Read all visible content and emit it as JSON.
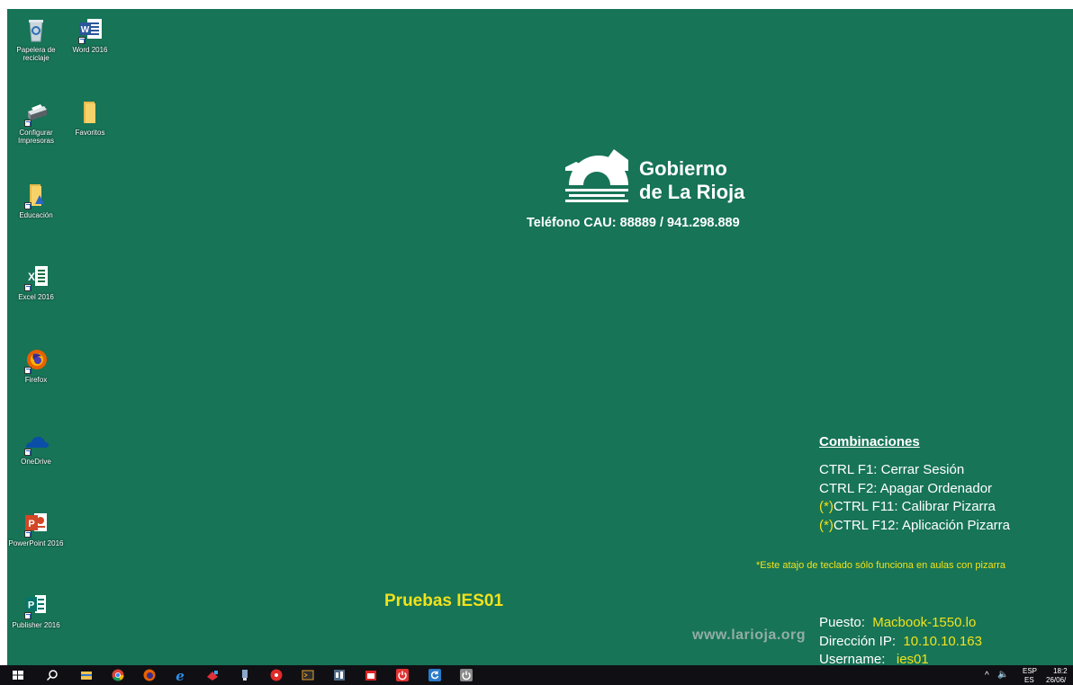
{
  "desktop": {
    "icons": [
      {
        "label": "Papelera de reciclaje",
        "icon": "recycle-bin-icon"
      },
      {
        "label": "Word 2016",
        "icon": "word-icon"
      },
      {
        "label": "Configurar Impresoras",
        "icon": "printer-icon"
      },
      {
        "label": "Favoritos",
        "icon": "folder-icon"
      },
      {
        "label": "Educación",
        "icon": "education-folder-icon"
      },
      {
        "label": "Excel 2016",
        "icon": "excel-icon"
      },
      {
        "label": "Firefox",
        "icon": "firefox-icon"
      },
      {
        "label": "OneDrive",
        "icon": "onedrive-icon"
      },
      {
        "label": "PowerPoint 2016",
        "icon": "powerpoint-icon"
      },
      {
        "label": "Publisher 2016",
        "icon": "publisher-icon"
      }
    ]
  },
  "wallpaper": {
    "logo_line1": "Gobierno",
    "logo_line2": "de La Rioja",
    "phone": "Teléfono CAU: 88889 / 941.298.889",
    "combinations_title": "Combinaciones",
    "shortcuts": [
      {
        "prefix": "",
        "text": "CTRL F1:  Cerrar Sesión"
      },
      {
        "prefix": "",
        "text": "CTRL F2:  Apagar Ordenador"
      },
      {
        "prefix": "(*)",
        "text": "CTRL F11:  Calibrar Pizarra"
      },
      {
        "prefix": "(*)",
        "text": "CTRL F12:  Aplicación Pizarra"
      }
    ],
    "note": "*Este atajo de teclado sólo funciona en aulas con pizarra",
    "lab_name": "Pruebas IES01",
    "watermark": "www.larioja.org",
    "puesto_label": "Puesto:",
    "puesto_value": "Macbook-1550.lo",
    "ip_label": "Dirección IP:",
    "ip_value": "10.10.10.163",
    "user_label": "Username:",
    "user_value": "ies01"
  },
  "colors": {
    "wallpaper": "#177456",
    "highlight": "#f2e21b",
    "taskbar": "#101014"
  },
  "taskbar": {
    "items": [
      "windows-start-icon",
      "search-icon",
      "file-explorer-icon",
      "chrome-icon",
      "firefox-icon",
      "edge-icon",
      "app-icon",
      "usb-icon",
      "music-icon",
      "terminal-icon",
      "tool-icon",
      "calendar-icon",
      "power-icon",
      "refresh-icon",
      "shutdown-icon"
    ],
    "tray": {
      "language_top": "ESP",
      "language_bottom": "ES",
      "time": "18:2",
      "date": "26/06/"
    }
  }
}
